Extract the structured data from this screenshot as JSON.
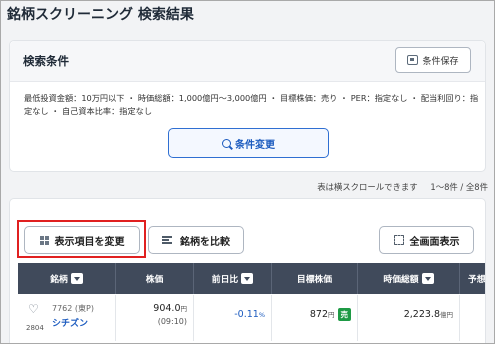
{
  "page": {
    "title": "銘柄スクリーニング 検索結果"
  },
  "conditions": {
    "title": "検索条件",
    "save_label": "条件保存",
    "text": "最低投資金額：10万円以下 ・ 時価総額：1,000億円〜3,000億円 ・ 目標株価：売り ・ PER：指定なし ・ 配当利回り：指定なし ・ 自己資本比率：指定なし",
    "change_label": "条件変更"
  },
  "results": {
    "note": "表は横スクロールできます",
    "range": "1〜8件 / 全8件",
    "buttons": {
      "columns_label": "表示項目を変更",
      "compare_label": "銘柄を比較",
      "fullscreen_label": "全画面表示"
    },
    "columns": [
      "銘柄",
      "株価",
      "前日比",
      "目標株価",
      "時価総額",
      "予想P"
    ],
    "rows": [
      {
        "code": "7762 (東P)",
        "name": "シチズン",
        "industry": "2804",
        "price": "904.0",
        "price_unit": "円",
        "time": "(09:10)",
        "change": "-0.11",
        "change_unit": "%",
        "target": "872",
        "target_unit": "円",
        "rating": "売",
        "market_cap": "2,223.8",
        "cap_unit": "億円"
      }
    ]
  },
  "colors": {
    "accent": "#2f6fd2",
    "header_bg": "#404a5b",
    "sell_badge": "#1e9a45",
    "highlight": "#e02020"
  }
}
